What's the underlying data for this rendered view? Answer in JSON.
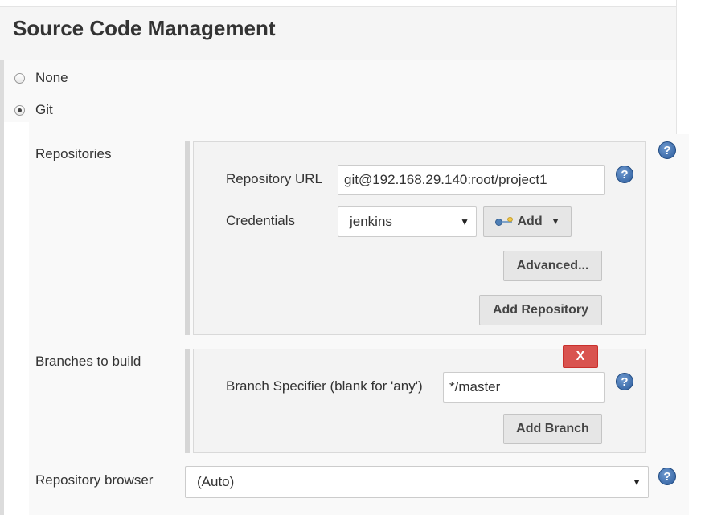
{
  "section": {
    "title": "Source Code Management"
  },
  "scm_options": [
    {
      "label": "None",
      "selected": false
    },
    {
      "label": "Git",
      "selected": true
    }
  ],
  "repositories": {
    "label": "Repositories",
    "url_label": "Repository URL",
    "url_value": "git@192.168.29.140:root/project1",
    "credentials_label": "Credentials",
    "credentials_value": "jenkins",
    "add_label": "Add",
    "advanced_label": "Advanced...",
    "add_repository_label": "Add Repository"
  },
  "branches": {
    "label": "Branches to build",
    "delete_label": "X",
    "specifier_label": "Branch Specifier (blank for 'any')",
    "specifier_value": "*/master",
    "add_branch_label": "Add Branch"
  },
  "repository_browser": {
    "label": "Repository browser",
    "value": "(Auto)"
  },
  "help": {
    "symbol": "?"
  },
  "icons": {
    "select_arrow": "▼",
    "dropdown_caret": "▼"
  },
  "colors": {
    "help_blue": "#2b5b9b",
    "delete_red": "#d9534f",
    "panel_bg": "#f3f3f3"
  }
}
